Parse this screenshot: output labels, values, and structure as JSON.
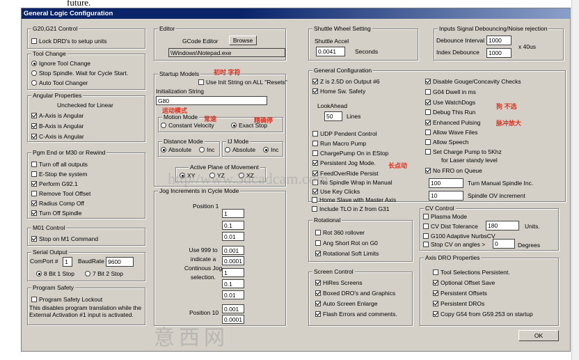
{
  "top_text": "future.",
  "window_title": "General Logic Configuration",
  "g20g21": {
    "title": "G20,G21 Control",
    "lock_drd": "Lock DRD's to setup units"
  },
  "tool_change": {
    "title": "Tool Change",
    "opt1": "Ignore Tool Change",
    "opt2": "Stop Spindle. Wait for Cycle Start.",
    "opt3": "Auto Tool Changer"
  },
  "angular": {
    "title": "Angular Properties",
    "note": "Unchecked for Linear",
    "a": "A-Axis is Angular",
    "b": "B-Axis is Angular",
    "c": "C-Axis is Angular"
  },
  "pgm_end": {
    "title": "Pgm End or M30 or Rewind",
    "i1": "Turn off all outputs",
    "i2": "E-Stop the system",
    "i3": "Perform G92.1",
    "i4": "Remove Tool Offset",
    "i5": "Radius Comp Off",
    "i6": "Turn Off Spindle"
  },
  "m01": {
    "title": "M01 Control",
    "stop": "Stop on M1 Command"
  },
  "serial": {
    "title": "Serial Output",
    "comport_label": "ComPort #",
    "comport": "1",
    "baud_label": "BaudRate",
    "baud": "9600",
    "opt1": "8 Bit 1 Stop",
    "opt2": "7 Bit 2 Stop"
  },
  "safety": {
    "title": "Program Safety",
    "lockout": "Program Safety Lockout",
    "note": "This disables program translation while the External Activation #1 input is activated."
  },
  "editor": {
    "title": "Editor",
    "label": "GCode Editor",
    "browse": "Browse",
    "path": "\\Windows\\Notepad.exe"
  },
  "startup": {
    "title": "Startup Models",
    "use_init": "Use Init String on ALL \"Resets\"",
    "init_label": "Initialization String",
    "init_value": "G80",
    "motion_title": "Motion Mode",
    "const_vel": "Constant Velocity",
    "exact_stop": "Exact Stop",
    "dist_title": "Distance Mode",
    "abs": "Absolute",
    "inc": "Inc",
    "ijmode_title": "IJ Mode",
    "ij_abs": "Absolute",
    "ij_inc": "Inc",
    "plane_title": "Active Plane of Movement",
    "xy": "XY",
    "yz": "YZ",
    "xz": "XZ"
  },
  "jog": {
    "title": "Jog Increments in Cycle Mode",
    "pos1": "Position 1",
    "note": "Use 999 to indicate a Continous Jog selection.",
    "pos10": "Position 10",
    "values": [
      "1",
      "0.1",
      "0.01",
      "0.001",
      "0.0001",
      "1",
      "0.1",
      "0.01",
      "0.001",
      "0.0001"
    ]
  },
  "shuttle": {
    "title": "Shuttle Wheel Setting",
    "accel_label": "Shuttle Accel",
    "accel": "0.0041",
    "seconds": "Seconds"
  },
  "debounce": {
    "title": "Inputs Signal Debouncing/Noise rejection",
    "interval_label": "Debounce Interval",
    "interval": "1000",
    "index_label": "Index Debounce",
    "index": "1000",
    "unit": "x 40us"
  },
  "general": {
    "title": "General Configuration",
    "z25": "Z is 2.5D on Output #6",
    "home_safety": "Home Sw. Safety",
    "lookahead_label": "LookAhead",
    "lookahead": "50",
    "lines": "Lines",
    "udp": "UDP Pendent Control",
    "macro_pump": "Run Macro Pump",
    "charge_pump": "ChargePump On in EStop",
    "persistent_jog": "Persistent Jog Mode.",
    "feed_override": "FeedOverRide Persist",
    "no_spindle": "No Spindle Wrap in Manual",
    "use_key": "Use Key Clicks",
    "home_slave": "Home Slave with Master Axis",
    "include_tlo": "Include TLO in Z from G31",
    "disable_gouge": "Disable Gouge/Concavity Checks",
    "g04": "G04 Dwell in ms",
    "use_watchdogs": "Use WatchDogs",
    "debug": "Debug This Run",
    "enhanced": "Enhanced Pulsing",
    "allow_wave": "Allow Wave Files",
    "allow_speech": "Allow Speech",
    "set_charge": "Set Charge Pump to 5Khz",
    "laser": "for Laser standy level",
    "no_fro": "No FRO on Queue",
    "turn_manual_val": "100",
    "turn_manual": "Turn Manual Spindle Inc.",
    "spindle_ov_val": "10",
    "spindle_ov": "Spindle OV increment"
  },
  "rotational": {
    "title": "Rotational",
    "rot360": "Rot 360 rollover",
    "ang_short": "Ang Short Rot on G0",
    "rot_soft": "Rotational Soft Limits"
  },
  "screen": {
    "title": "Screen Control",
    "hires": "HiRes Screens",
    "boxed": "Boxed DRO's and Graphics",
    "auto_enlarge": "Auto Screen Enlarge",
    "flash": "Flash Errors and comments."
  },
  "cv": {
    "title": "CV Control",
    "plasma": "Plasma Mode",
    "cv_dist_label": "CV Dist Tolerance",
    "cv_dist": "180",
    "units": "Units.",
    "g100": "G100 Adaptive NurbsCV",
    "stop_cv": "Stop CV on angles >",
    "stop_cv_val": "0",
    "degrees": "Degrees"
  },
  "axis_dro": {
    "title": "Axis DRO Properties",
    "tool_sel": "Tool Selections Persistent.",
    "opt_offset": "Optional Offset Save",
    "pers_offsets": "Persistent Offsets",
    "pers_dros": "Persistent DROs",
    "copy_g54": "Copy G54 from G59.253 on startup"
  },
  "ok": "OK",
  "annotations": {
    "a1": "初时 字符",
    "a2": "运动模式",
    "a3": "常速",
    "a4": "精确停",
    "a5": "长点动",
    "a6": "狗 不选",
    "a7": "脉冲放大"
  },
  "watermark": {
    "w1": "http//www.3dcadcam.com",
    "w2": "意西网"
  }
}
